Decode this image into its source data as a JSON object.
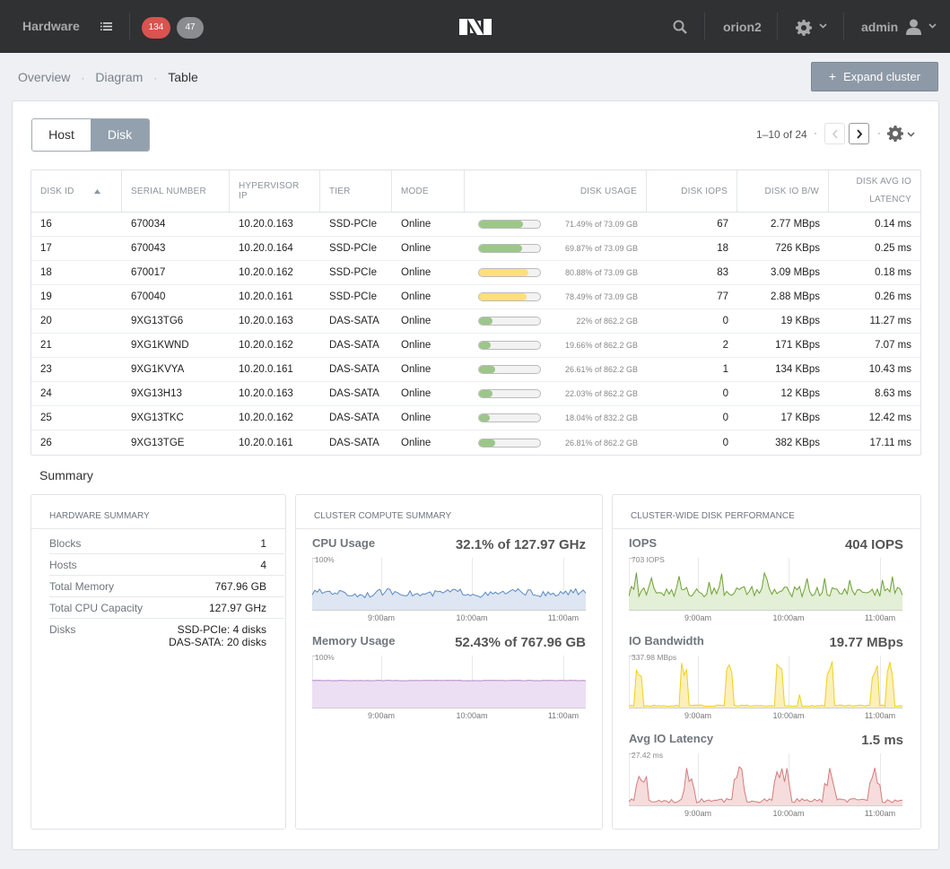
{
  "topbar": {
    "title": "Hardware",
    "alert_count": "134",
    "event_count": "47",
    "cluster_name": "orion2",
    "user_name": "admin"
  },
  "breadcrumb": {
    "overview": "Overview",
    "diagram": "Diagram",
    "table": "Table"
  },
  "expand_button": "Expand cluster",
  "view_toggle": {
    "host": "Host",
    "disk": "Disk"
  },
  "pagination": {
    "range": "1–10 of 24"
  },
  "table": {
    "headers": {
      "disk_id": "DISK ID",
      "serial": "SERIAL NUMBER",
      "hypervisor_ip": "HYPERVISOR IP",
      "tier": "TIER",
      "mode": "MODE",
      "usage": "DISK USAGE",
      "iops": "DISK IOPS",
      "bw": "DISK IO B/W",
      "latency": "DISK AVG IO LATENCY"
    },
    "rows": [
      {
        "id": "16",
        "serial": "670034",
        "ip": "10.20.0.163",
        "tier": "SSD-PCIe",
        "mode": "Online",
        "usage_pct": 71.49,
        "usage": "71.49% of 73.09 GB",
        "level": "green",
        "iops": "67",
        "bw": "2.77 MBps",
        "lat": "0.14 ms"
      },
      {
        "id": "17",
        "serial": "670043",
        "ip": "10.20.0.164",
        "tier": "SSD-PCIe",
        "mode": "Online",
        "usage_pct": 69.87,
        "usage": "69.87% of 73.09 GB",
        "level": "green",
        "iops": "18",
        "bw": "726 KBps",
        "lat": "0.25 ms"
      },
      {
        "id": "18",
        "serial": "670017",
        "ip": "10.20.0.162",
        "tier": "SSD-PCIe",
        "mode": "Online",
        "usage_pct": 80.88,
        "usage": "80.88% of 73.09 GB",
        "level": "yellow",
        "iops": "83",
        "bw": "3.09 MBps",
        "lat": "0.18 ms"
      },
      {
        "id": "19",
        "serial": "670040",
        "ip": "10.20.0.161",
        "tier": "SSD-PCIe",
        "mode": "Online",
        "usage_pct": 78.49,
        "usage": "78.49% of 73.09 GB",
        "level": "yellow",
        "iops": "77",
        "bw": "2.88 MBps",
        "lat": "0.26 ms"
      },
      {
        "id": "20",
        "serial": "9XG13TG6",
        "ip": "10.20.0.163",
        "tier": "DAS-SATA",
        "mode": "Online",
        "usage_pct": 22,
        "usage": "22% of 862.2 GB",
        "level": "green",
        "iops": "0",
        "bw": "19 KBps",
        "lat": "11.27 ms"
      },
      {
        "id": "21",
        "serial": "9XG1KWND",
        "ip": "10.20.0.162",
        "tier": "DAS-SATA",
        "mode": "Online",
        "usage_pct": 19.66,
        "usage": "19.66% of 862.2 GB",
        "level": "green",
        "iops": "2",
        "bw": "171 KBps",
        "lat": "7.07 ms"
      },
      {
        "id": "23",
        "serial": "9XG1KVYA",
        "ip": "10.20.0.161",
        "tier": "DAS-SATA",
        "mode": "Online",
        "usage_pct": 26.61,
        "usage": "26.61% of 862.2 GB",
        "level": "green",
        "iops": "1",
        "bw": "134 KBps",
        "lat": "10.43 ms"
      },
      {
        "id": "24",
        "serial": "9XG13H13",
        "ip": "10.20.0.163",
        "tier": "DAS-SATA",
        "mode": "Online",
        "usage_pct": 22.03,
        "usage": "22.03% of 862.2 GB",
        "level": "green",
        "iops": "0",
        "bw": "12 KBps",
        "lat": "8.63 ms"
      },
      {
        "id": "25",
        "serial": "9XG13TKC",
        "ip": "10.20.0.162",
        "tier": "DAS-SATA",
        "mode": "Online",
        "usage_pct": 18.04,
        "usage": "18.04% of 832.2 GB",
        "level": "green",
        "iops": "0",
        "bw": "17 KBps",
        "lat": "12.42 ms"
      },
      {
        "id": "26",
        "serial": "9XG13TGE",
        "ip": "10.20.0.161",
        "tier": "DAS-SATA",
        "mode": "Online",
        "usage_pct": 26.81,
        "usage": "26.81% of 862.2 GB",
        "level": "green",
        "iops": "0",
        "bw": "382 KBps",
        "lat": "17.11 ms"
      }
    ]
  },
  "summary": {
    "title": "Summary",
    "hardware": {
      "heading": "HARDWARE SUMMARY",
      "rows": [
        {
          "k": "Blocks",
          "v": "1"
        },
        {
          "k": "Hosts",
          "v": "4"
        },
        {
          "k": "Total Memory",
          "v": "767.96 GB"
        },
        {
          "k": "Total CPU Capacity",
          "v": "127.97 GHz"
        },
        {
          "k": "Disks",
          "v": "SSD-PCIe: 4 disks\nDAS-SATA: 20 disks"
        }
      ]
    },
    "compute": {
      "heading": "CLUSTER COMPUTE SUMMARY",
      "cpu": {
        "label": "CPU Usage",
        "value": "32.1% of 127.97 GHz",
        "max": "100%"
      },
      "memory": {
        "label": "Memory Usage",
        "value": "52.43% of 767.96 GB",
        "max": "100%"
      }
    },
    "disk_perf": {
      "heading": "CLUSTER-WIDE DISK PERFORMANCE",
      "iops": {
        "label": "IOPS",
        "value": "404 IOPS",
        "max": "703 IOPS"
      },
      "bandwidth": {
        "label": "IO Bandwidth",
        "value": "19.77 MBps",
        "max": "337.98 MBps"
      },
      "latency": {
        "label": "Avg IO Latency",
        "value": "1.5 ms",
        "max": "27.42 ms"
      }
    },
    "time_ticks": [
      "9:00am",
      "10:00am",
      "11:00am"
    ]
  },
  "colors": {
    "cpu_line": "#5b88c4",
    "cpu_fill": "#dde6f2",
    "mem_line": "#b58ac8",
    "mem_fill": "#ecdff3",
    "iops_line": "#6fa034",
    "iops_fill": "#e3efd6",
    "bw_line": "#f0cf1f",
    "bw_fill": "#fbf0b8",
    "lat_line": "#d47b7b",
    "lat_fill": "#f6dcdc"
  }
}
